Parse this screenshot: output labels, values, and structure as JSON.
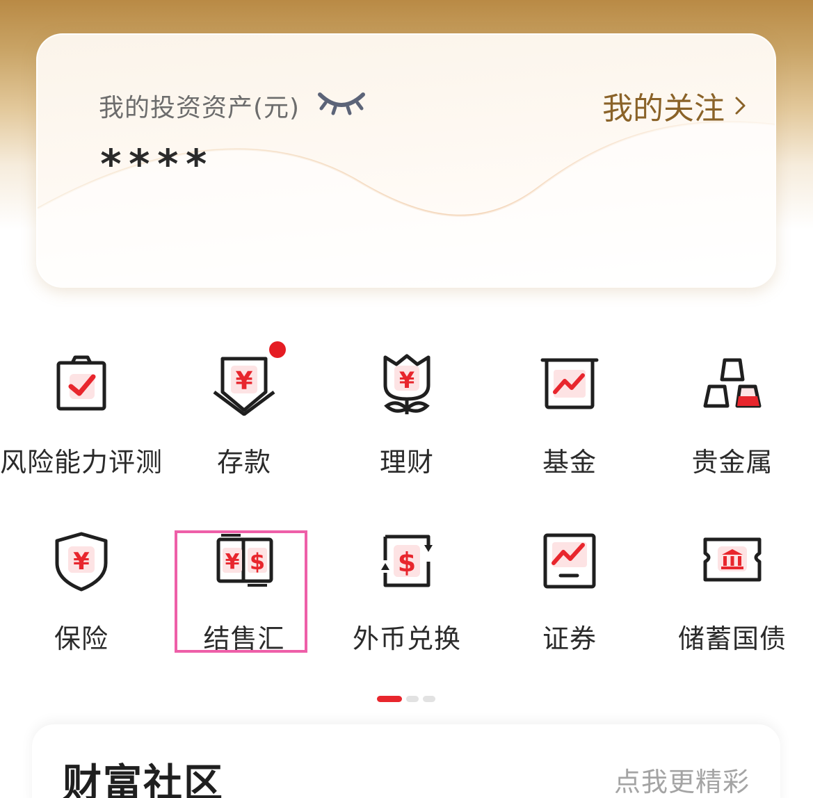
{
  "asset_card": {
    "label": "我的投资资产(元)",
    "value": "****",
    "eye_icon": "eye-closed-icon",
    "follow_link": "我的关注"
  },
  "services": [
    {
      "label": "风险能力评测",
      "icon": "clipboard-check-icon"
    },
    {
      "label": "存款",
      "icon": "yuan-deposit-icon",
      "badge": "red-dot"
    },
    {
      "label": "理财",
      "icon": "yuan-flower-icon"
    },
    {
      "label": "基金",
      "icon": "chart-trend-icon"
    },
    {
      "label": "贵金属",
      "icon": "gold-bars-icon"
    },
    {
      "label": "保险",
      "icon": "yuan-shield-icon"
    },
    {
      "label": "结售汇",
      "icon": "yuan-dollar-exchange-icon"
    },
    {
      "label": "外币兑换",
      "icon": "dollar-exchange-icon"
    },
    {
      "label": "证券",
      "icon": "stock-chart-icon"
    },
    {
      "label": "储蓄国债",
      "icon": "bond-ticket-icon"
    }
  ],
  "pager": {
    "pages": 3,
    "current": 1
  },
  "community": {
    "title": "财富社区",
    "more": "点我更精彩"
  },
  "colors": {
    "accent_red": "#e8262d",
    "gold_text": "#8a6228",
    "highlight": "#ee5fa8"
  }
}
